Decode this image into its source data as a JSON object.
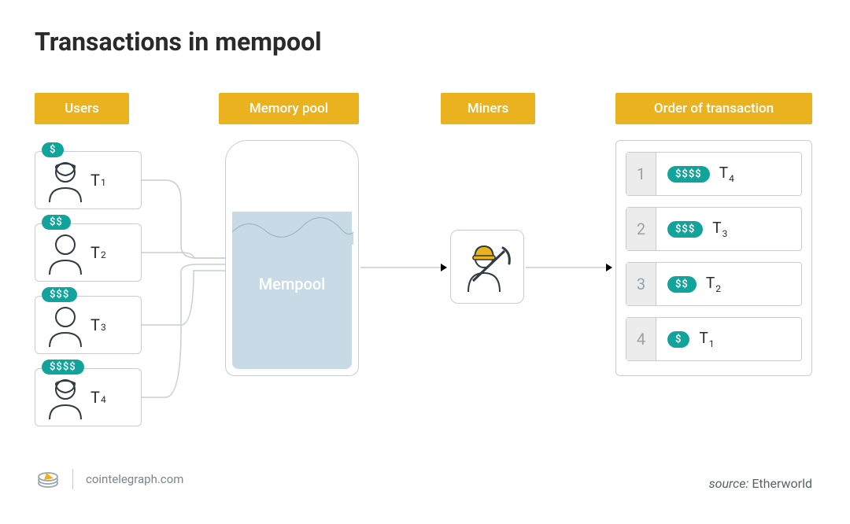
{
  "title": "Transactions in mempool",
  "columns": {
    "users": "Users",
    "mempool": "Memory pool",
    "miners": "Miners",
    "order": "Order of transaction"
  },
  "users": [
    {
      "fee": "$",
      "tx_prefix": "T",
      "tx_suffix": "1"
    },
    {
      "fee": "$$",
      "tx_prefix": "T",
      "tx_suffix": "2"
    },
    {
      "fee": "$$$",
      "tx_prefix": "T",
      "tx_suffix": "3"
    },
    {
      "fee": "$$$$",
      "tx_prefix": "T",
      "tx_suffix": "4"
    }
  ],
  "mempool_label": "Mempool",
  "order": [
    {
      "rank": "1",
      "fee": "$$$$",
      "tx_prefix": "T",
      "tx_suffix": "4"
    },
    {
      "rank": "2",
      "fee": "$$$",
      "tx_prefix": "T",
      "tx_suffix": "3"
    },
    {
      "rank": "3",
      "fee": "$$",
      "tx_prefix": "T",
      "tx_suffix": "2"
    },
    {
      "rank": "4",
      "fee": "$",
      "tx_prefix": "T",
      "tx_suffix": "1"
    }
  ],
  "footer": {
    "site": "cointelegraph.com",
    "source_label": "source:",
    "source_name": "Etherworld"
  },
  "colors": {
    "accent": "#eab21f",
    "teal": "#12a49a",
    "line": "#c9cdd1"
  }
}
